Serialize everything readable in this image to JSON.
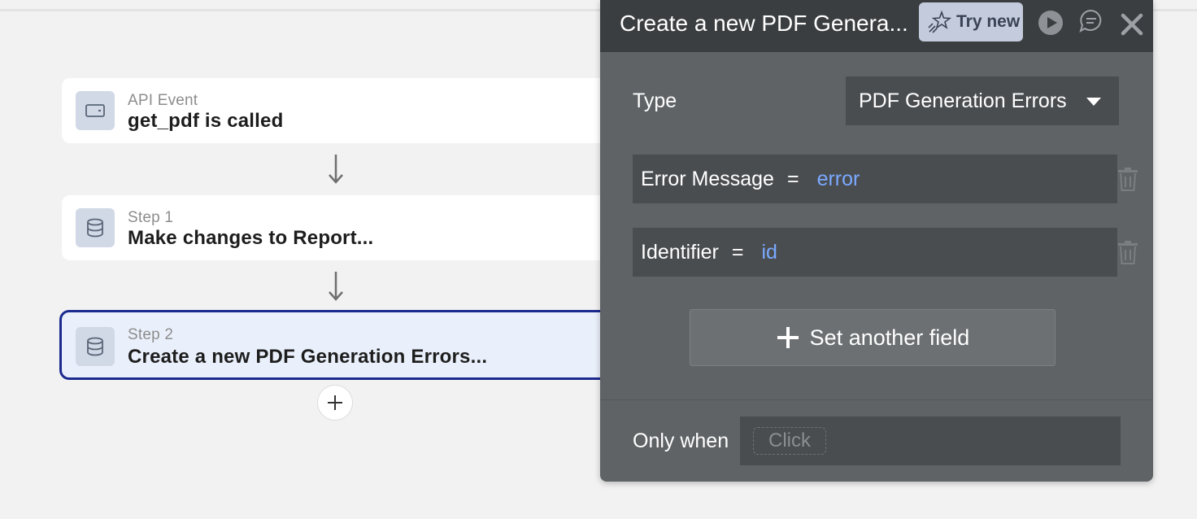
{
  "workflow": {
    "event": {
      "caption": "API Event",
      "title": "get_pdf is called",
      "icon": "api-icon"
    },
    "steps": [
      {
        "caption": "Step 1",
        "title": "Make changes to Report...",
        "icon": "database-icon"
      },
      {
        "caption": "Step 2",
        "title": "Create a new PDF Generation Errors...",
        "icon": "database-icon",
        "selected": true
      }
    ],
    "add_step_icon": "plus-icon"
  },
  "panel": {
    "title": "Create a new PDF Genera...",
    "try_new_label": "Try new",
    "type_label": "Type",
    "type_value": "PDF Generation Errors",
    "fields": [
      {
        "name": "Error Message",
        "operator": "=",
        "value": "error"
      },
      {
        "name": "Identifier",
        "operator": "=",
        "value": "id"
      }
    ],
    "set_another_field_label": "Set another field",
    "only_when_label": "Only when",
    "only_when_placeholder": "Click"
  },
  "colors": {
    "selected_border": "#1b2a8f",
    "selected_bg": "#eaf0fb",
    "panel_bg": "#5f6366",
    "panel_header_bg": "#3b3e40",
    "dynamic_value": "#7aa9ff",
    "try_new_bg": "#c4cbdc"
  }
}
